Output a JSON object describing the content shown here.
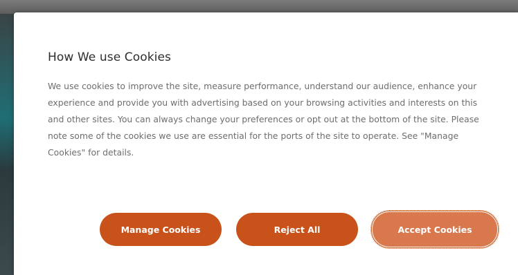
{
  "cookie_dialog": {
    "title": "How We use Cookies",
    "body": "We use cookies to improve the site, measure performance, understand our audience, enhance your experience and provide you with advertising based on your browsing activities and interests on this and other sites. You can always change your preferences or opt out at the bottom of the site. Please note some of the cookies we use are essential for the ports of the site to operate. See \"Manage Cookies\" for details.",
    "buttons": {
      "manage_label": "Manage Cookies",
      "reject_label": "Reject All",
      "accept_label": "Accept Cookies"
    }
  },
  "colors": {
    "button_primary": "#c9521b",
    "button_focused": "#d9784d",
    "title_text": "#2d2d2d",
    "body_text": "#6d6d6d",
    "dialog_background": "#ffffff"
  }
}
